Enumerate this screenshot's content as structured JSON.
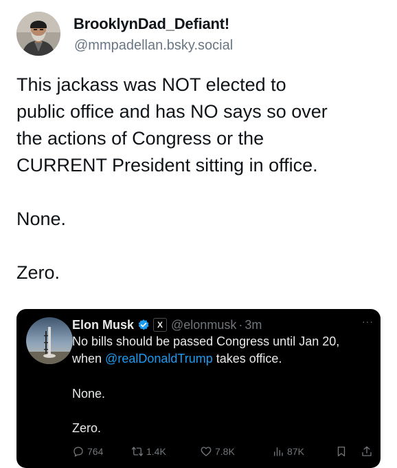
{
  "post": {
    "display_name": "BrooklynDad_Defiant!",
    "handle": "@mmpadellan.bsky.social",
    "body_lines": [
      "This jackass was NOT elected to",
      "public office and has NO says so over",
      "the actions of Congress or the",
      "CURRENT President sitting in office."
    ],
    "line_none": "None.",
    "line_zero": "Zero."
  },
  "tweet": {
    "name": "Elon Musk",
    "x_badge": "X",
    "handle": "@elonmusk",
    "separator": "·",
    "time": "3m",
    "more": "···",
    "text_line1": "No bills should be passed Congress until Jan 20,",
    "text_when": "when ",
    "mention": "@realDonaldTrump",
    "text_after": " takes office.",
    "line_none": "None.",
    "line_zero": "Zero.",
    "replies": "764",
    "reposts": "1.4K",
    "likes": "7.8K",
    "views": "87K"
  },
  "colors": {
    "verified": "#1d9bf0",
    "mention": "#1d9bf0",
    "handle_gray": "#687684",
    "tweet_bg": "#000000"
  },
  "icons": {
    "reply": "reply-icon",
    "repost": "repost-icon",
    "like": "like-icon",
    "views": "views-icon",
    "bookmark": "bookmark-icon",
    "share": "share-icon",
    "verified": "verified-badge-icon"
  }
}
